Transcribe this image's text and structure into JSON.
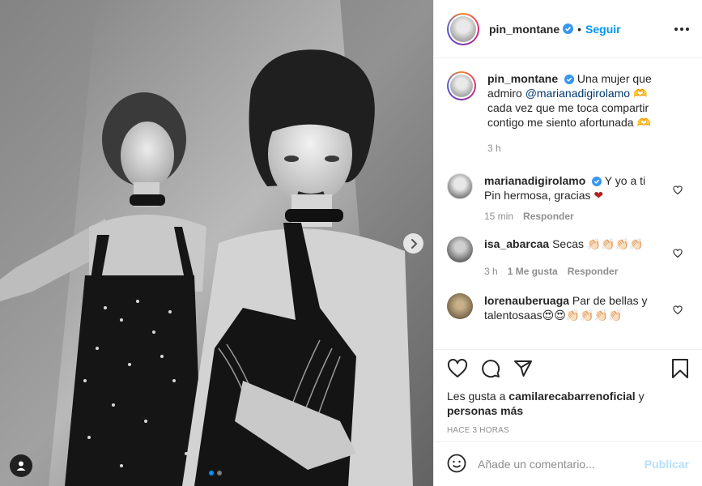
{
  "post": {
    "username": "pin_montane",
    "follow_label": "Seguir",
    "separator": "•",
    "caption": {
      "username": "pin_montane",
      "text_before": "Una mujer que admiro ",
      "mention": "@marianadigirolamo",
      "text_after": " 🫶 cada vez que me toca compartir contigo me siento afortunada 🫶",
      "time": "3 h"
    },
    "comments": [
      {
        "username": "marianadigirolamo",
        "verified": true,
        "text": "Y yo a ti Pin hermosa, gracias ❤",
        "time": "15 min",
        "likes": "",
        "reply_label": "Responder"
      },
      {
        "username": "isa_abarcaa",
        "verified": false,
        "text": "Secas 👏🏻👏🏻👏🏻👏🏻",
        "time": "3 h",
        "likes": "1 Me gusta",
        "reply_label": "Responder"
      },
      {
        "username": "lorenauberuaga",
        "verified": false,
        "text": "Par de bellas y talentosaas😍😍👏🏻👏🏻👏🏻👏🏻",
        "time": "",
        "likes": "",
        "reply_label": ""
      }
    ],
    "likes": {
      "prefix": "Les gusta a ",
      "user": "camilarecabarrenoficial",
      "suffix": " y ",
      "others": "personas más"
    },
    "time_ago": "HACE 3 HORAS",
    "add_comment_placeholder": "Añade un comentario...",
    "publish_label": "Publicar"
  },
  "colors": {
    "accent": "#0095f6",
    "text": "#262626",
    "secondary": "#8e8e8e",
    "heart_red": "#b22222"
  },
  "icons": [
    "verified-icon",
    "more-options-icon",
    "heart-icon",
    "comment-icon",
    "share-icon",
    "bookmark-icon",
    "emoji-icon",
    "next-arrow-icon",
    "user-tag-icon"
  ]
}
